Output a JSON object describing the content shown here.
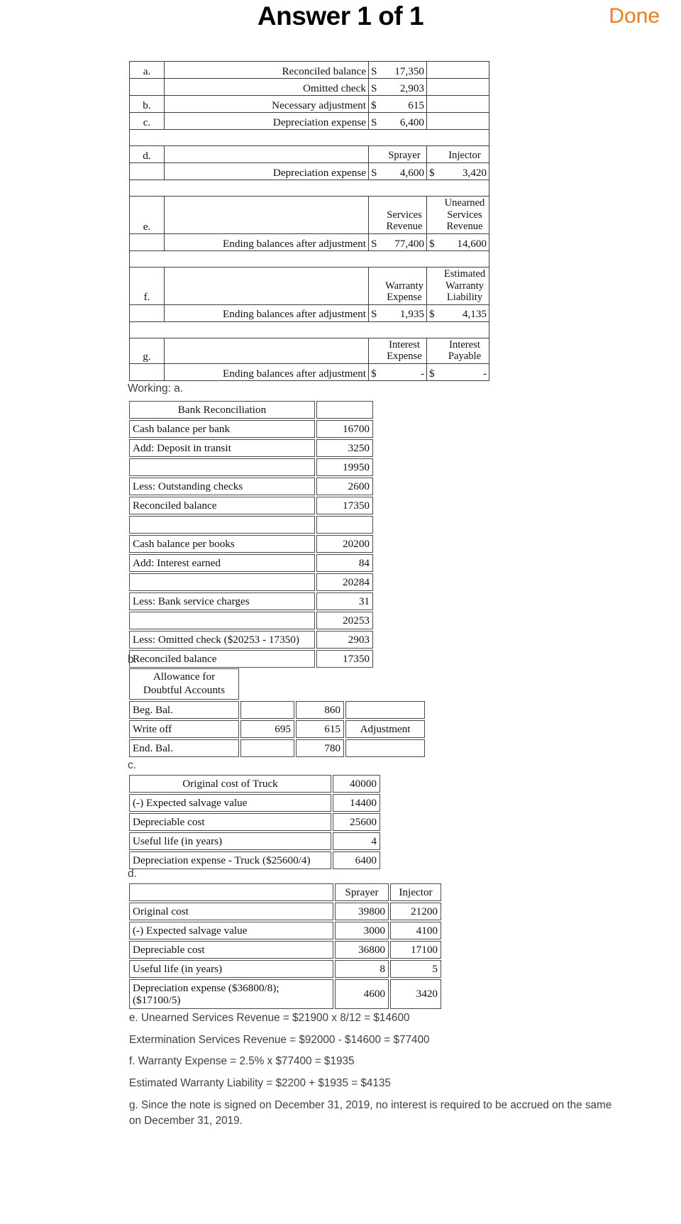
{
  "header": {
    "title": "Answer 1 of 1",
    "done_label": "Done"
  },
  "summary_table": {
    "rows": [
      {
        "letter": "a.",
        "label": "Reconciled balance",
        "dollar": "S",
        "value": "17,350",
        "dollar2": "",
        "value2": ""
      },
      {
        "letter": "",
        "label": "Omitted check",
        "dollar": "S",
        "value": "2,903",
        "dollar2": "",
        "value2": ""
      },
      {
        "letter": "b.",
        "label": "Necessary adjustment",
        "dollar": "$",
        "value": "615",
        "dollar2": "",
        "value2": ""
      },
      {
        "letter": "c.",
        "label": "Depreciation expense",
        "dollar": "S",
        "value": "6,400",
        "dollar2": "",
        "value2": ""
      }
    ],
    "d": {
      "letter": "d.",
      "head1": "Sprayer",
      "head2": "Injector",
      "label": "Depreciation expense",
      "dollar": "S",
      "value": "4,600",
      "dollar2": "$",
      "value2": "3,420"
    },
    "e": {
      "letter": "e.",
      "head1": "Services\nRevenue",
      "head1_l1": "Services",
      "head1_l2": "Revenue",
      "head2_l1": "Unearned",
      "head2_l2": "Services",
      "head2_l3": "Revenue",
      "label": "Ending balances after adjustment",
      "dollar": "S",
      "value": "77,400",
      "dollar2": "$",
      "value2": "14,600"
    },
    "f": {
      "letter": "f.",
      "head1_l1": "Warranty",
      "head1_l2": "Expense",
      "head2_l1": "Estimated",
      "head2_l2": "Warranty",
      "head2_l3": "Liability",
      "label": "Ending balances after adjustment",
      "dollar": "S",
      "value": "1,935",
      "dollar2": "$",
      "value2": "4,135"
    },
    "g": {
      "letter": "g.",
      "head1_l1": "Interest",
      "head1_l2": "Expense",
      "head2_l1": "Interest",
      "head2_l2": "Payable",
      "label": "Ending balances after adjustment",
      "dollar": "$",
      "value": "-",
      "dollar2": "$",
      "value2": "-"
    }
  },
  "working_labels": {
    "a": "Working: a.",
    "b": "b.",
    "c": "c.",
    "d": "d."
  },
  "bank_reconciliation": {
    "title": "Bank Reconciliation",
    "title_value": "",
    "rows": [
      {
        "label": "Cash balance per bank",
        "value": "16700"
      },
      {
        "label": "Add: Deposit in transit",
        "value": "3250"
      },
      {
        "label": "",
        "value": "19950"
      },
      {
        "label": "Less: Outstanding checks",
        "value": "2600"
      },
      {
        "label": "Reconciled balance",
        "value": "17350"
      },
      {
        "label": "",
        "value": ""
      },
      {
        "label": "Cash balance per books",
        "value": "20200"
      },
      {
        "label": "Add: Interest earned",
        "value": "84"
      },
      {
        "label": "",
        "value": "20284"
      },
      {
        "label": "Less: Bank service charges",
        "value": "31"
      },
      {
        "label": "",
        "value": "20253"
      },
      {
        "label": "Less: Omitted check ($20253 - 17350)",
        "value": "2903"
      },
      {
        "label": "Reconciled balance",
        "value": "17350"
      }
    ]
  },
  "allowance": {
    "title_l1": "Allowance for",
    "title_l2": "Doubtful Accounts",
    "rows": [
      {
        "label": "Beg. Bal.",
        "c2": "",
        "c3": "860",
        "c4": ""
      },
      {
        "label": "Write off",
        "c2": "695",
        "c3": "615",
        "c4": "Adjustment"
      },
      {
        "label": "End. Bal.",
        "c2": "",
        "c3": "780",
        "c4": ""
      }
    ]
  },
  "truck": {
    "rows": [
      {
        "label": "Original cost of Truck",
        "value": "40000",
        "center": true
      },
      {
        "label": "(-) Expected salvage value",
        "value": "14400",
        "center": false
      },
      {
        "label": "Depreciable cost",
        "value": "25600",
        "center": false
      },
      {
        "label": "Useful life (in years)",
        "value": "4",
        "center": false
      },
      {
        "label": "Depreciation expense - Truck ($25600/4)",
        "value": "6400",
        "center": false
      }
    ]
  },
  "assets": {
    "header": {
      "label": "",
      "col1": "Sprayer",
      "col2": "Injector"
    },
    "rows": [
      {
        "label": "Original cost",
        "v1": "39800",
        "v2": "21200"
      },
      {
        "label": "(-) Expected salvage value",
        "v1": "3000",
        "v2": "4100"
      },
      {
        "label": "Depreciable cost",
        "v1": "36800",
        "v2": "17100"
      },
      {
        "label": "Useful life (in years)",
        "v1": "8",
        "v2": "5"
      }
    ],
    "last_row": {
      "label_l1": "Depreciation expense ($36800/8);",
      "label_l2": "($17100/5)",
      "v1": "4600",
      "v2": "3420"
    }
  },
  "notes": [
    "e. Unearned Services Revenue = $21900 x 8/12 = $14600",
    "Extermination Services Revenue = $92000 - $14600 = $77400",
    "f. Warranty Expense = 2.5% x $77400 = $1935",
    "Estimated Warranty Liability = $2200 + $1935 = $4135",
    "g. Since the note is signed on December 31, 2019, no interest is required to be accrued on the same on December 31, 2019."
  ],
  "colors": {
    "accent": "#ef7d19",
    "text": "#3c4043",
    "border": "#3c3c3c"
  }
}
